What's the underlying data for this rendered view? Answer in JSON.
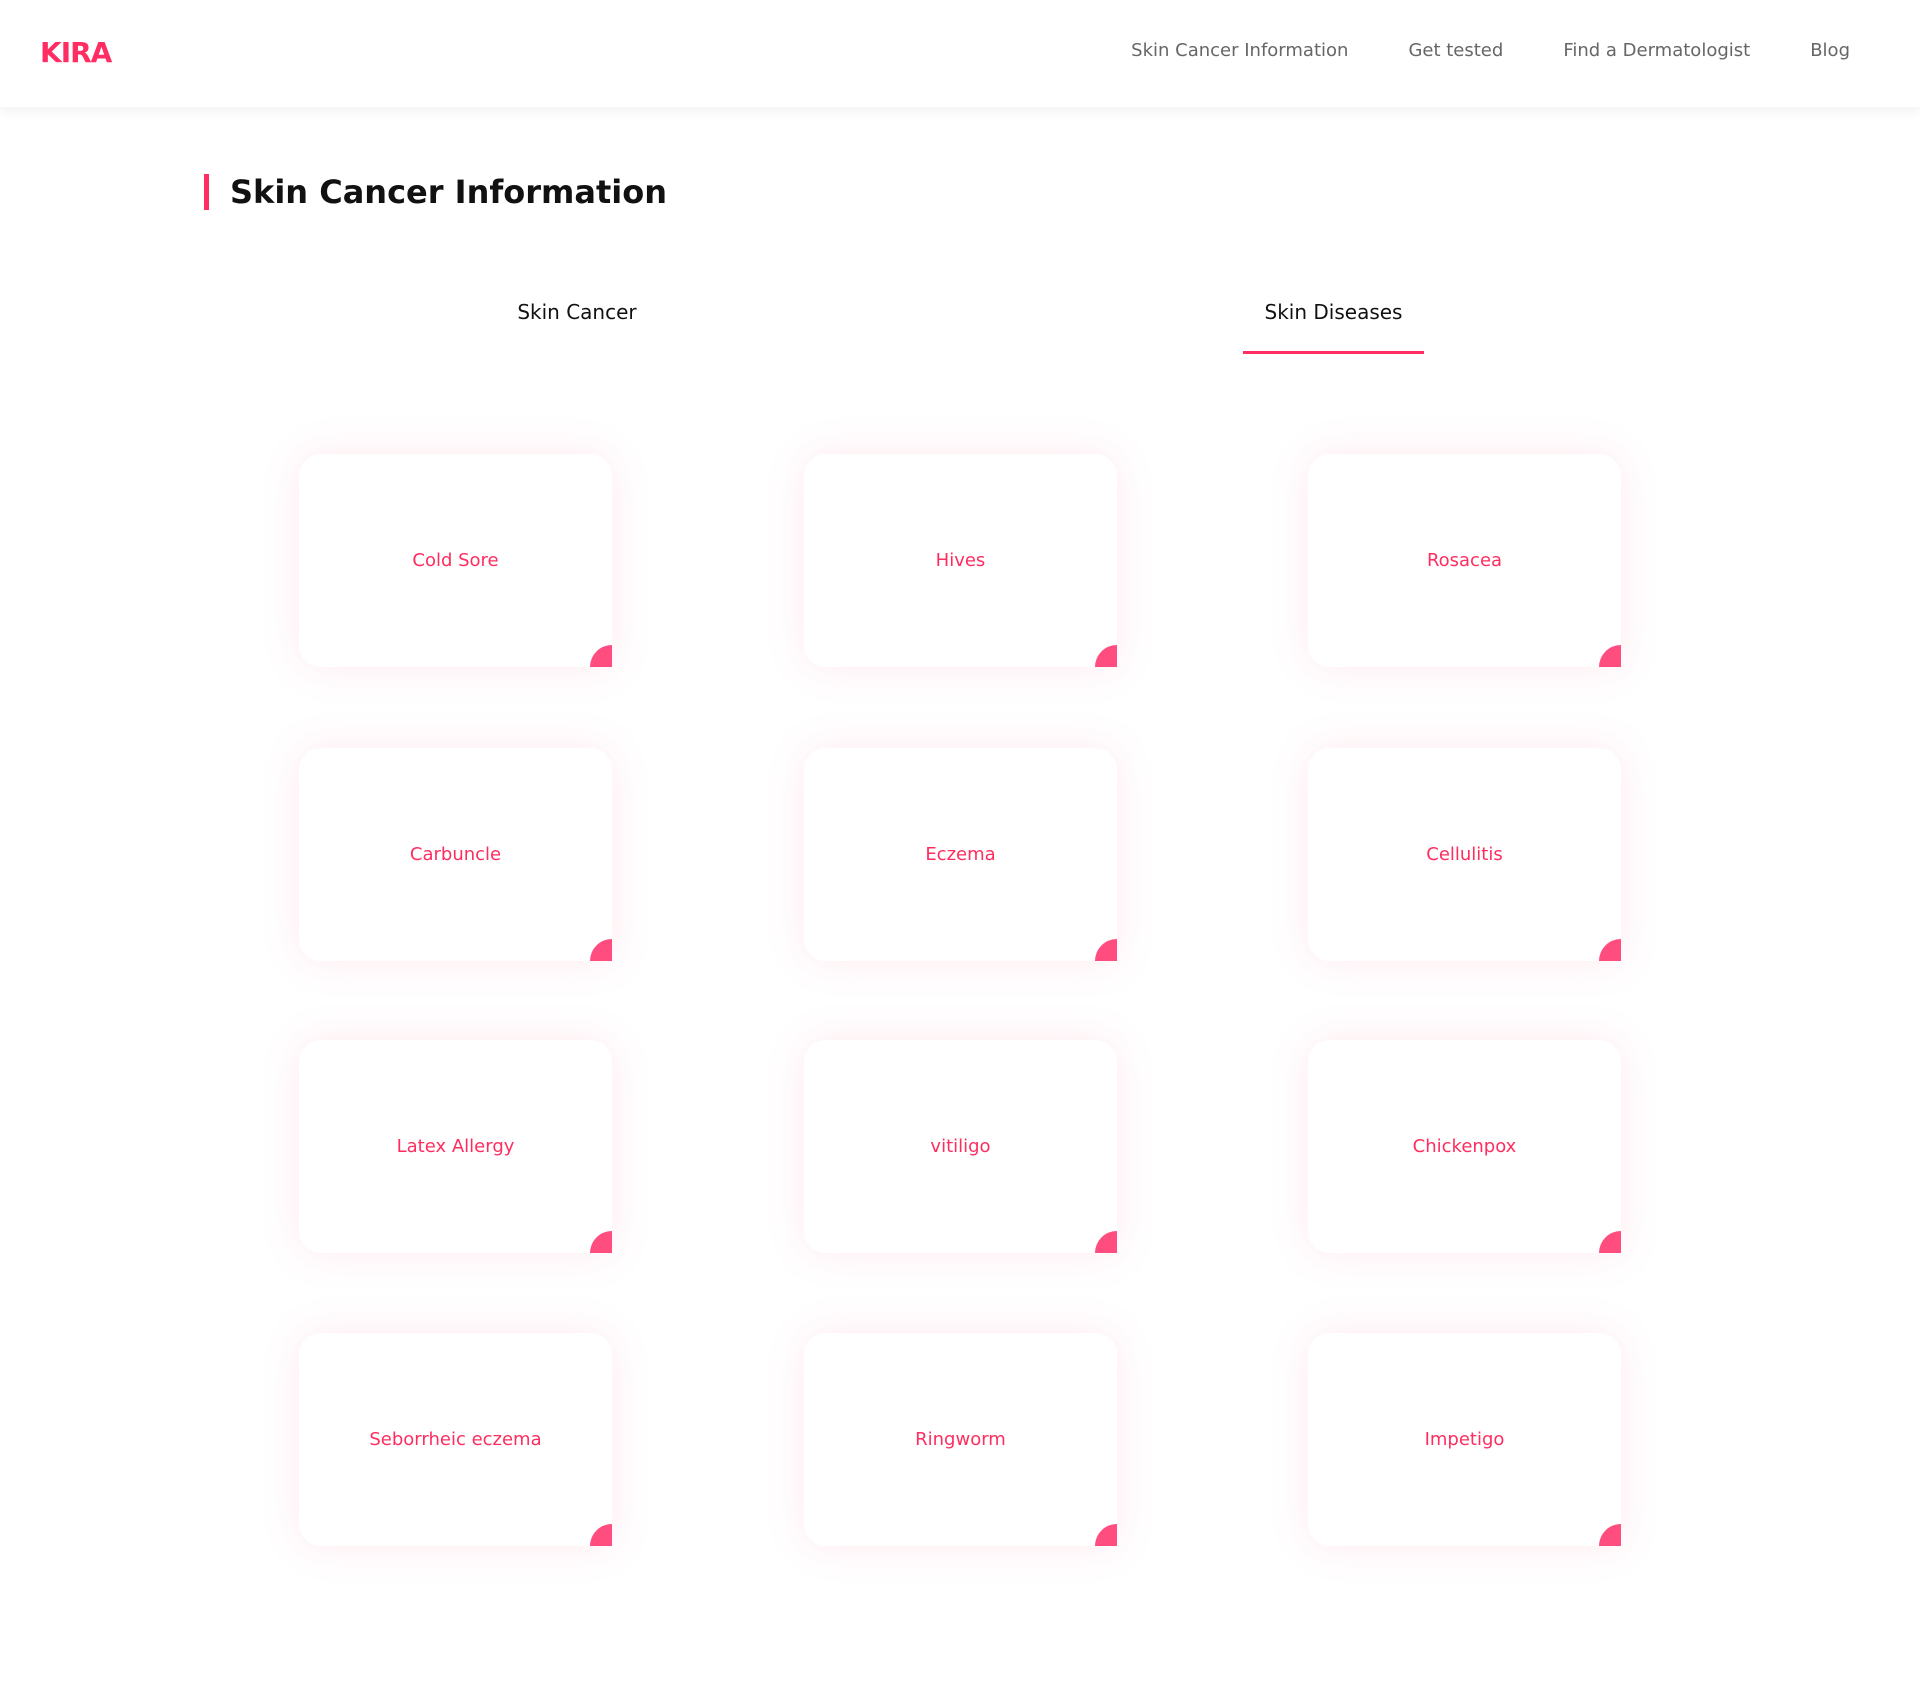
{
  "header": {
    "logo": "KIRA",
    "nav": [
      "Skin Cancer Information",
      "Get tested",
      "Find a Dermatologist",
      "Blog"
    ]
  },
  "page_title": "Skin Cancer Information",
  "tabs": [
    {
      "label": "Skin Cancer",
      "active": false
    },
    {
      "label": "Skin Diseases",
      "active": true
    }
  ],
  "cards": [
    "Cold Sore",
    "Hives",
    "Rosacea",
    "Carbuncle",
    "Eczema",
    "Cellulitis",
    "Latex Allergy",
    "vitiligo",
    "Chickenpox",
    "Seborrheic eczema",
    "Ringworm",
    "Impetigo"
  ],
  "colors": {
    "accent": "#ff2d62",
    "card_corner": "#ff4d80"
  }
}
